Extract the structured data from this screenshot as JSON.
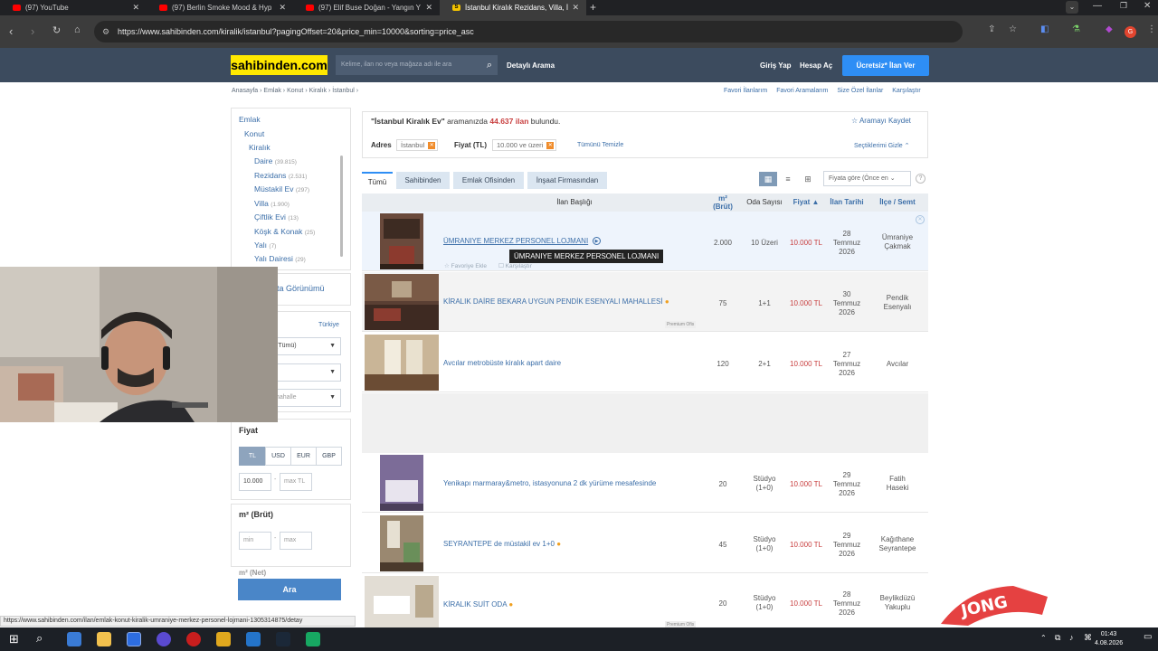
{
  "browser": {
    "tabs": [
      {
        "title": "(97) YouTube",
        "icon": "youtube-icon"
      },
      {
        "title": "(97) Berlin Smoke Mood & Hyp",
        "icon": "youtube-icon"
      },
      {
        "title": "(97) Elif Buse Doğan - Yangın Y",
        "icon": "youtube-icon"
      },
      {
        "title": "İstanbul Kiralık Rezidans, Villa, İ",
        "icon": "sahibinden-icon"
      }
    ],
    "url": "https://www.sahibinden.com/kiralik/istanbul?pagingOffset=20&price_min=10000&sorting=price_asc"
  },
  "site": {
    "logo": "sahibinden.com",
    "search_placeholder": "Kelime, ilan no veya mağaza adı ile ara",
    "detailed_search": "Detaylı Arama",
    "login": "Giriş Yap",
    "signup": "Hesap Aç",
    "post_ad": "Ücretsiz* İlan Ver"
  },
  "breadcrumb": "Anasayfa  ›  Emlak  ›  Konut  ›  Kiralık  ›  İstanbul  ›",
  "top_links": [
    "Favori İlanlarım",
    "Favori Aramalarım",
    "Size Özel İlanlar",
    "Karşılaştır"
  ],
  "sidebar": {
    "categories": [
      {
        "label": "Emlak",
        "count": ""
      },
      {
        "label": "Konut",
        "count": ""
      },
      {
        "label": "Kiralık",
        "count": ""
      },
      {
        "label": "Daire",
        "count": "(39.815)"
      },
      {
        "label": "Rezidans",
        "count": "(2.531)"
      },
      {
        "label": "Müstakil Ev",
        "count": "(297)"
      },
      {
        "label": "Villa",
        "count": "(1.900)"
      },
      {
        "label": "Çiftlik Evi",
        "count": "(13)"
      },
      {
        "label": "Köşk & Konak",
        "count": "(25)"
      },
      {
        "label": "Yalı",
        "count": "(7)"
      },
      {
        "label": "Yalı Dairesi",
        "count": "(29)"
      }
    ],
    "map_view": "ta Görünümü",
    "country": "Türkiye",
    "district_select": "(Tümü)",
    "neighborhood_select": "hahalle",
    "price_title": "Fiyat",
    "currencies": [
      "TL",
      "USD",
      "EUR",
      "GBP"
    ],
    "price_min": "10.000",
    "price_max_placeholder": "max TL",
    "area_gross_title": "m² (Brüt)",
    "area_min_placeholder": "min",
    "area_max_placeholder": "max",
    "area_net_title": "m² (Net)",
    "search_button": "Ara"
  },
  "results": {
    "query": "\"İstanbul Kiralık Ev\"",
    "middle": " aramanızda ",
    "count": "44.637 ilan",
    "suffix": " bulundu.",
    "save_search": "☆ Aramayı Kaydet",
    "address_label": "Adres",
    "address_value": "İstanbul",
    "price_label": "Fiyat (TL)",
    "price_value": "10.000 ve üzeri",
    "clear_all": "Tümünü Temizle",
    "hide_selected": "Seçtiklerimi Gizle ⌃"
  },
  "result_tabs": [
    "Tümü",
    "Sahibinden",
    "Emlak Ofisinden",
    "İnşaat Firmasından"
  ],
  "sort": "Fiyata göre (Önce en ⌄",
  "columns": [
    "İlan Başlığı",
    "m²\n(Brüt)",
    "Oda Sayısı",
    "Fiyat ▲",
    "İlan Tarihi",
    "İlçe / Semt"
  ],
  "listings": [
    {
      "title": "ÜMRANIYE MERKEZ PERSONEL LOJMANI",
      "area": "2.000",
      "rooms": "10 Üzeri",
      "price": "10.000 TL",
      "date": [
        "28",
        "Temmuz",
        "2026"
      ],
      "location": [
        "Ümraniye",
        "Çakmak"
      ]
    },
    {
      "title": "KİRALIK DAİRE BEKARA UYGUN PENDİK ESENYALI MAHALLESİ",
      "area": "75",
      "rooms": "1+1",
      "price": "10.000 TL",
      "date": [
        "30",
        "Temmuz",
        "2026"
      ],
      "location": [
        "Pendik",
        "Esenyalı"
      ]
    },
    {
      "title": "Avcılar metrobüste kiralık apart daire",
      "area": "120",
      "rooms": "2+1",
      "price": "10.000 TL",
      "date": [
        "27",
        "Temmuz",
        "2026"
      ],
      "location": [
        "Avcılar",
        ""
      ]
    },
    {
      "title": "Yenikapı marmaray&metro, istasyonuna 2 dk yürüme mesafesinde",
      "area": "20",
      "rooms": "Stüdyo\n(1+0)",
      "price": "10.000 TL",
      "date": [
        "29",
        "Temmuz",
        "2026"
      ],
      "location": [
        "Fatih",
        "Haseki"
      ]
    },
    {
      "title": "SEYRANTEPE de müstakil ev 1+0",
      "area": "45",
      "rooms": "Stüdyo\n(1+0)",
      "price": "10.000 TL",
      "date": [
        "29",
        "Temmuz",
        "2026"
      ],
      "location": [
        "Kağıthane",
        "Seyrantepe"
      ]
    },
    {
      "title": "KİRALIK SUİT ODA",
      "area": "20",
      "rooms": "Stüdyo\n(1+0)",
      "price": "10.000 TL",
      "date": [
        "28",
        "Temmuz",
        "2026"
      ],
      "location": [
        "Beylikdüzü",
        "Yakuplu"
      ]
    }
  ],
  "tooltip": "ÜMRANIYE MERKEZ PERSONEL LOJMANI",
  "favorite_add": "Favoriye Ekle",
  "compare": "Karşılaştır",
  "premium_badge": "Premium Ofis",
  "status_url": "https://www.sahibinden.com/ilan/emlak-konut-kiralik-umraniye-merkez-personel-lojmani-1305314875/detay",
  "clock": {
    "time": "01:43",
    "date": "4.08.2026"
  },
  "colors": {
    "header": "#3c4b5e",
    "logo_bg": "#ffe800",
    "accent_blue": "#2e8ef5",
    "price_red": "#c83e3e"
  }
}
